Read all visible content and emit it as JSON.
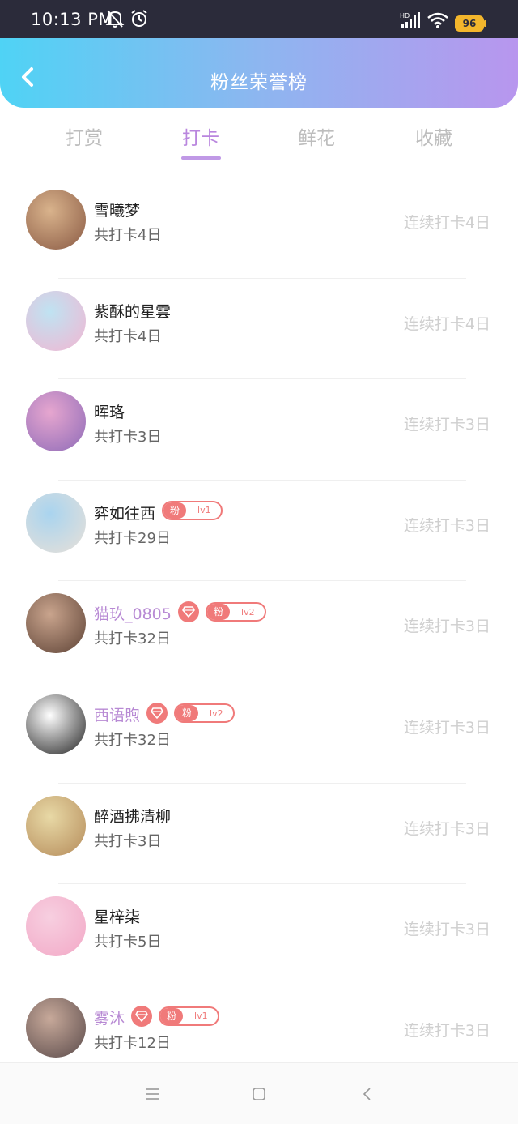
{
  "status_bar": {
    "time": "10:13 PM",
    "battery": "96"
  },
  "header": {
    "title": "粉丝荣誉榜"
  },
  "tabs": [
    {
      "label": "打赏"
    },
    {
      "label": "打卡"
    },
    {
      "label": "鲜花"
    },
    {
      "label": "收藏"
    }
  ],
  "fans": [
    {
      "name": "雪曦梦",
      "total": "共打卡4日",
      "streak": "连续打卡4日",
      "vip": false,
      "gem": false,
      "badge": null
    },
    {
      "name": "紫酥的星雲",
      "total": "共打卡4日",
      "streak": "连续打卡4日",
      "vip": false,
      "gem": false,
      "badge": null
    },
    {
      "name": "晖珞",
      "total": "共打卡3日",
      "streak": "连续打卡3日",
      "vip": false,
      "gem": false,
      "badge": null
    },
    {
      "name": "弈如往西",
      "total": "共打卡29日",
      "streak": "连续打卡3日",
      "vip": false,
      "gem": false,
      "badge": {
        "label": "粉",
        "level": "lv1"
      }
    },
    {
      "name": "猫玖_0805",
      "total": "共打卡32日",
      "streak": "连续打卡3日",
      "vip": true,
      "gem": true,
      "badge": {
        "label": "粉",
        "level": "lv2"
      }
    },
    {
      "name": "西语煦",
      "total": "共打卡32日",
      "streak": "连续打卡3日",
      "vip": true,
      "gem": true,
      "badge": {
        "label": "粉",
        "level": "lv2"
      }
    },
    {
      "name": "醉酒拂清柳",
      "total": "共打卡3日",
      "streak": "连续打卡3日",
      "vip": false,
      "gem": false,
      "badge": null
    },
    {
      "name": "星梓柒",
      "total": "共打卡5日",
      "streak": "连续打卡3日",
      "vip": false,
      "gem": false,
      "badge": null
    },
    {
      "name": "雾沐",
      "total": "共打卡12日",
      "streak": "连续打卡3日",
      "vip": true,
      "gem": true,
      "badge": {
        "label": "粉",
        "level": "lv1"
      }
    }
  ],
  "avatar_colors": [
    [
      "#d9b38c",
      "#8a5a44"
    ],
    [
      "#bfe3f2",
      "#f2b6d2"
    ],
    [
      "#e6a6cf",
      "#8e6bb8"
    ],
    [
      "#a9d4ef",
      "#e8e0d8"
    ],
    [
      "#c9a48d",
      "#5e4336"
    ],
    [
      "#ffffff",
      "#222222"
    ],
    [
      "#e8d9a6",
      "#b58b5a"
    ],
    [
      "#f7cfe0",
      "#f2a8c6"
    ],
    [
      "#c7a99a",
      "#5a4a4a"
    ]
  ],
  "colors": {
    "accent": "#b986de",
    "badge": "#f07a7a",
    "vip_name": "#b88ad4"
  }
}
